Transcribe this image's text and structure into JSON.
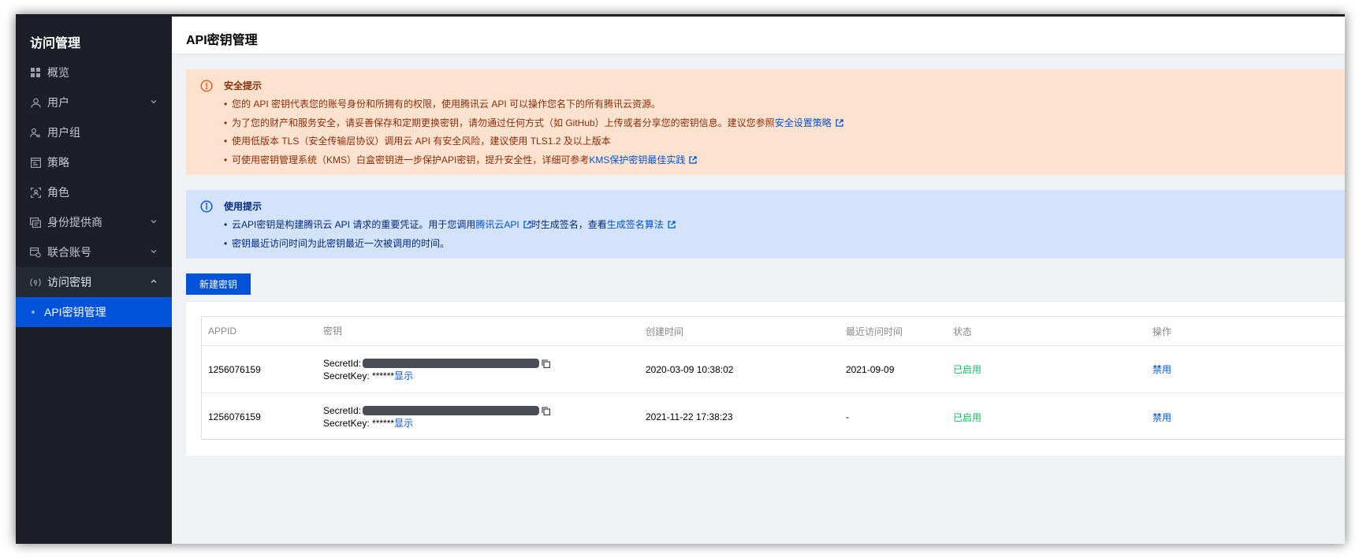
{
  "sidebar": {
    "title": "访问管理",
    "items": [
      {
        "label": "概览",
        "icon": "grid-icon",
        "expandable": false
      },
      {
        "label": "用户",
        "icon": "user-icon",
        "expandable": true
      },
      {
        "label": "用户组",
        "icon": "user-group-icon",
        "expandable": false
      },
      {
        "label": "策略",
        "icon": "policy-icon",
        "expandable": false
      },
      {
        "label": "角色",
        "icon": "role-icon",
        "expandable": false
      },
      {
        "label": "身份提供商",
        "icon": "identity-provider-icon",
        "expandable": true
      },
      {
        "label": "联合账号",
        "icon": "federated-account-icon",
        "expandable": true
      },
      {
        "label": "访问密钥",
        "icon": "access-key-icon",
        "expanded": true
      },
      {
        "label": "API密钥管理",
        "active": true
      }
    ]
  },
  "header": {
    "title": "API密钥管理"
  },
  "warning": {
    "title": "安全提示",
    "lines": [
      {
        "text": "您的 API 密钥代表您的账号身份和所拥有的权限，使用腾讯云 API 可以操作您名下的所有腾讯云资源。"
      },
      {
        "text": "为了您的财产和服务安全，请妥善保存和定期更换密钥，请勿通过任何方式（如 GitHub）上传或者分享您的密钥信息。建议您参照",
        "link": "安全设置策略"
      },
      {
        "text": "使用低版本 TLS（安全传输层协议）调用云 API 有安全风险，建议使用 TLS1.2 及以上版本"
      },
      {
        "text": "可使用密钥管理系统（KMS）白盒密钥进一步保护API密钥，提升安全性，详细可参考",
        "link": "KMS保护密钥最佳实践"
      }
    ]
  },
  "info": {
    "title": "使用提示",
    "line1": {
      "text_a": "云API密钥是构建腾讯云 API 请求的重要凭证。用于您调用",
      "link_a": "腾讯云API",
      "text_b": "时生成签名，查看",
      "link_b": "生成签名算法"
    },
    "line2": "密钥最近访问时间为此密钥最近一次被调用的时间。"
  },
  "actions": {
    "new_key": "新建密钥"
  },
  "table": {
    "columns": [
      "APPID",
      "密钥",
      "创建时间",
      "最近访问时间",
      "状态",
      "操作"
    ],
    "secret_id_label": "SecretId:",
    "secret_key_label": "SecretKey:",
    "secret_key_masked": "******",
    "show_label": "显示",
    "rows": [
      {
        "appid": "1256076159",
        "created": "2020-03-09 10:38:02",
        "last_access": "2021-09-09",
        "status": "已启用",
        "operation": "禁用"
      },
      {
        "appid": "1256076159",
        "created": "2021-11-22 17:38:23",
        "last_access": "-",
        "status": "已启用",
        "operation": "禁用"
      }
    ]
  },
  "colors": {
    "brand": "#0052d9",
    "success": "#0abf5b",
    "sidebar_bg": "#1c1f28",
    "warning_bg": "#fde3cf",
    "info_bg": "#d4e3fc"
  }
}
